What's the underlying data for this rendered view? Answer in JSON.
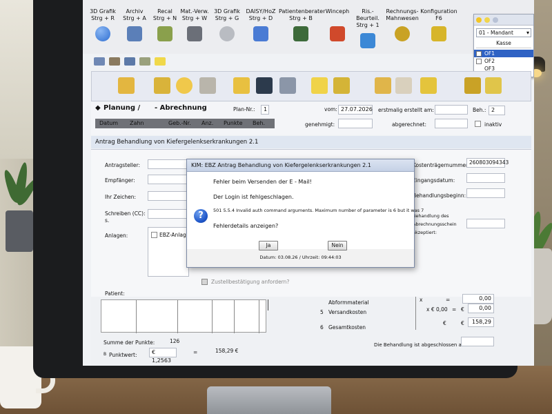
{
  "menu": [
    {
      "line1": "3D Grafik",
      "line2": "Strg + R",
      "icon": "globe-icon",
      "color": "#2f6fd1"
    },
    {
      "line1": "Archiv",
      "line2": "Strg + A",
      "icon": "archive-users-icon",
      "color": "#5b7fb8"
    },
    {
      "line1": "Recal",
      "line2": "Strg + N",
      "icon": "recall-users-icon",
      "color": "#8aa04c"
    },
    {
      "line1": "Mat.-Verw.",
      "line2": "Strg + W",
      "icon": "tools-icon",
      "color": "#6b6f78"
    },
    {
      "line1": "3D Grafik",
      "line2": "Strg + G",
      "icon": "tooth-icon",
      "color": "#b9bcc2"
    },
    {
      "line1": "DAISY/HoZ",
      "line2": "Strg + D",
      "icon": "daisy-icon",
      "color": "#4a7bd4"
    },
    {
      "line1": "Patientenberater",
      "line2": "Strg + B",
      "icon": "advisor-icon",
      "color": "#3d6a3a"
    },
    {
      "line1": "Winceph",
      "line2": "",
      "icon": "winceph-icon",
      "color": "#d0492b"
    },
    {
      "line1": "Ris.-Beurteil.",
      "line2": "Strg + 1",
      "icon": "risk-icon",
      "color": "#3c88d6"
    },
    {
      "line1": "Rechnungs-",
      "line2": "Mahnwesen",
      "icon": "money-bag-icon",
      "color": "#c9a224"
    },
    {
      "line1": "Konfiguration",
      "line2": "F6",
      "icon": "config-icon",
      "color": "#d7b52a"
    }
  ],
  "mandant": {
    "select": "01 - Mandant",
    "kasse_label": "Kasse",
    "items": [
      {
        "label": "OF1",
        "checked": false,
        "selected": true
      },
      {
        "label": "OF2",
        "checked": false,
        "selected": false
      },
      {
        "label": "OF3",
        "checked": false,
        "selected": false
      }
    ]
  },
  "header": {
    "planung": "Planung /",
    "abrechnung": "Abrechnung",
    "plan_nr_label": "Plan-Nr.:",
    "plan_nr": "1",
    "vom_label": "vom:",
    "vom_value": "27.07.2026",
    "erstellt_label": "erstmalig erstellt am:",
    "beh_label": "Beh.:",
    "beh_value": "2",
    "genehmigt_label": "genehmigt:",
    "abgerechnet_label": "abgerechnet:",
    "inaktiv_label": "inaktiv",
    "columns": [
      "Datum",
      "Zahn",
      "Geb.-Nr.",
      "Anz.",
      "Punkte",
      "Beh."
    ]
  },
  "section_title": "Antrag Behandlung von Kiefergelenkserkrankungen 2.1",
  "form": {
    "antragsteller": "Antragsteller:",
    "empfaenger": "Empfänger:",
    "ihr_zeichen": "Ihr Zeichen:",
    "schreiben_cc_1": "Schreiben (CC):",
    "schreiben_cc_2": "s.",
    "anlagen": "Anlagen:",
    "ebz_anlage": "EBZ-Anlage",
    "zustell": "Zustellbestätigung anfordern?",
    "patient": "Patient:",
    "kostentraeger_label": "Kostenträgernummer:",
    "kostentraeger_value": "260803094343",
    "eingangsdatum": "Eingangsdatum:",
    "behandlungsbeginn": "Behandlungsbeginn:",
    "behandlung_des_1": "Behandlung des",
    "behandlung_des_2": "Abrechnungsschein",
    "behandlung_des_3": "akzeptiert:"
  },
  "bottom": {
    "abformmaterial": "Abformmaterial",
    "versandkosten": "Versandkosten",
    "gesamtkosten": "Gesamtkosten",
    "num5": "5",
    "num6": "6",
    "x1": "x",
    "eq1": "=",
    "val1": "0,00",
    "x2": "x € 0,00",
    "eq2": "=",
    "eur2": "€",
    "val2": "0,00",
    "eur3": "€",
    "eur3b": "€",
    "val3": "158,29",
    "summe_label": "Summe der Punkte:",
    "summe_value": "126",
    "punktwert_label": "Punktwert:",
    "punktwert_prefix": "B",
    "punktwert_value": "€ 1,2563",
    "eq3": "=",
    "total": "158,29 €",
    "abgeschlossen": "Die Behandlung ist abgeschlossen am:"
  },
  "dialog": {
    "title": "KIM: EBZ Antrag Behandlung von Kiefergelenkserkrankungen 2.1",
    "line1": "Fehler beim Versenden der E - Mail!",
    "line2": "Der Login ist fehlgeschlagen.",
    "line3": "501 5.5.4 Invalid auth command arguments. Maximum number of parameter is 6 but it was 7",
    "line4": "Fehlerdetails anzeigen?",
    "yes": "Ja",
    "no": "Nein",
    "footer": "Datum: 03.08.26 / Uhrzeit: 09:44:03"
  }
}
